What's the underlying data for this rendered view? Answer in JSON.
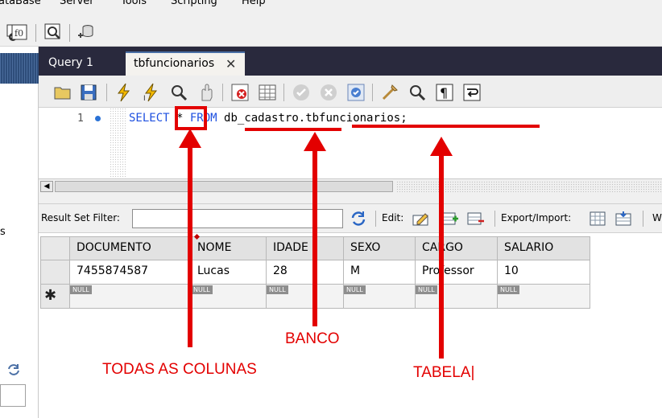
{
  "menu": {
    "items": [
      "ataBase",
      "Server",
      "Tools",
      "Scripting",
      "Help"
    ]
  },
  "tabs": {
    "query1": "Query 1",
    "active": "tbfuncionarios"
  },
  "editor": {
    "line_number": "1",
    "sql": {
      "kw_select": "SELECT",
      "star": " * ",
      "kw_from": "FROM",
      "schema": "db_cadastro",
      "dot": ".",
      "table": "tbfuncionarios",
      "semicolon": ";"
    }
  },
  "left_panel": {
    "letter": "s"
  },
  "result_bar": {
    "filter_label": "Result Set Filter:",
    "edit_label": "Edit:",
    "export_label": "Export/Import:",
    "wrap_label": "W"
  },
  "grid": {
    "columns": [
      "DOCUMENTO",
      "NOME",
      "IDADE",
      "SEXO",
      "CARGO",
      "SALARIO"
    ],
    "rows": [
      [
        "7455874587",
        "Lucas",
        "28",
        "M",
        "Professor",
        "10"
      ]
    ],
    "null_label": "NULL",
    "new_row_marker": "✱"
  },
  "annotations": {
    "todas": "TODAS AS COLUNAS",
    "banco": "BANCO",
    "tabela": "TABELA|",
    "color": "#e30000"
  }
}
